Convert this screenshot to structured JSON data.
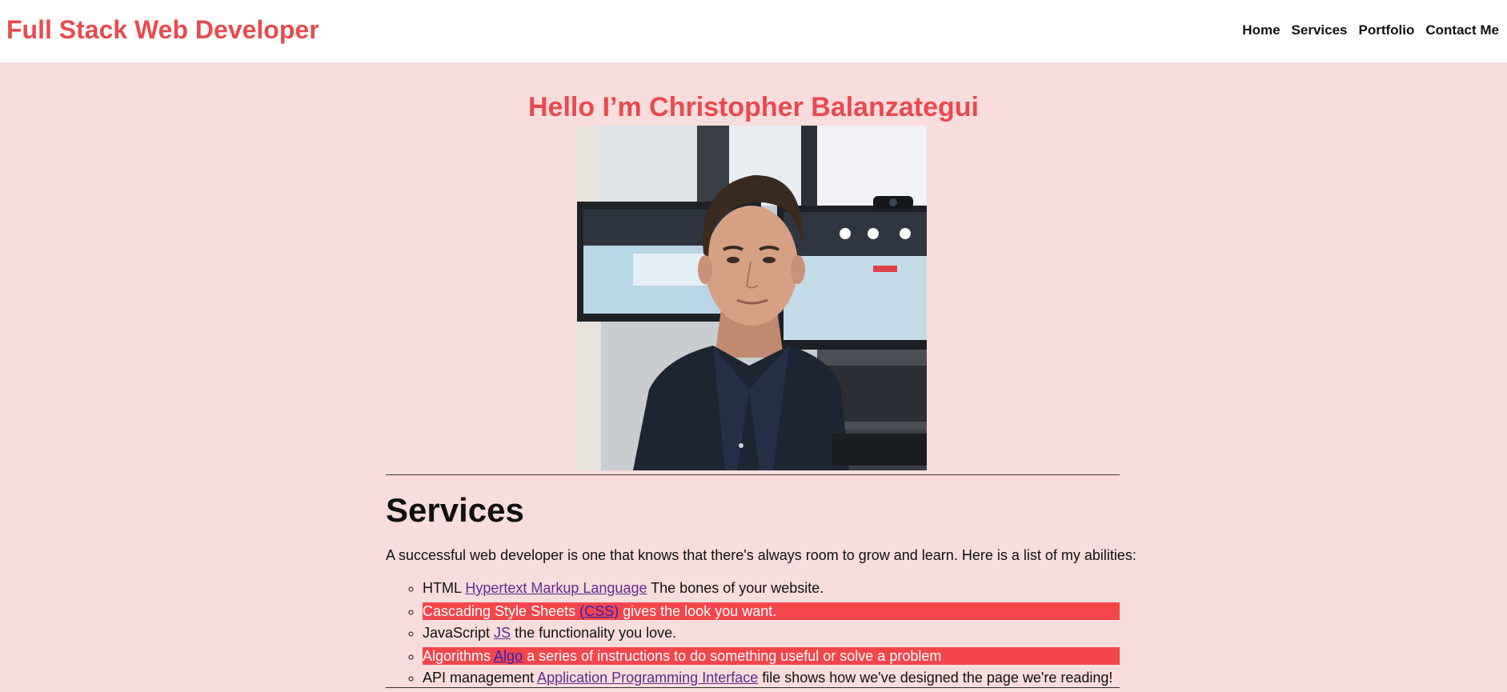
{
  "header": {
    "brand": "Full Stack Web Developer",
    "nav": [
      "Home",
      "Services",
      "Portfolio",
      "Contact Me"
    ]
  },
  "hero": {
    "title": "Hello I’m Christopher Balanzategui",
    "photo_alt": "Portrait photo of Christopher Balanzategui"
  },
  "services": {
    "title": "Services",
    "intro": "A successful web developer is one that knows that there's always room to grow and learn. Here is a list of my abilities:",
    "items": [
      {
        "prefix": "HTML ",
        "link": "Hypertext Markup Language",
        "suffix": " The bones of your website."
      },
      {
        "prefix": "Cascading Style Sheets ",
        "link": "(CSS)",
        "suffix": " gives the look you want."
      },
      {
        "prefix": "JavaScript ",
        "link": "JS",
        "suffix": " the functionality you love."
      },
      {
        "prefix": "Algorithms ",
        "link": "Algo",
        "suffix": " a series of instructions to do something useful or solve a problem"
      },
      {
        "prefix": "API management ",
        "link": "Application Programming Interface",
        "suffix": " file shows how we've designed the page we're reading!"
      }
    ]
  },
  "colors": {
    "accent": "#e84a4f",
    "page_bg": "#f9dcdc",
    "highlight": "#f2464b"
  }
}
